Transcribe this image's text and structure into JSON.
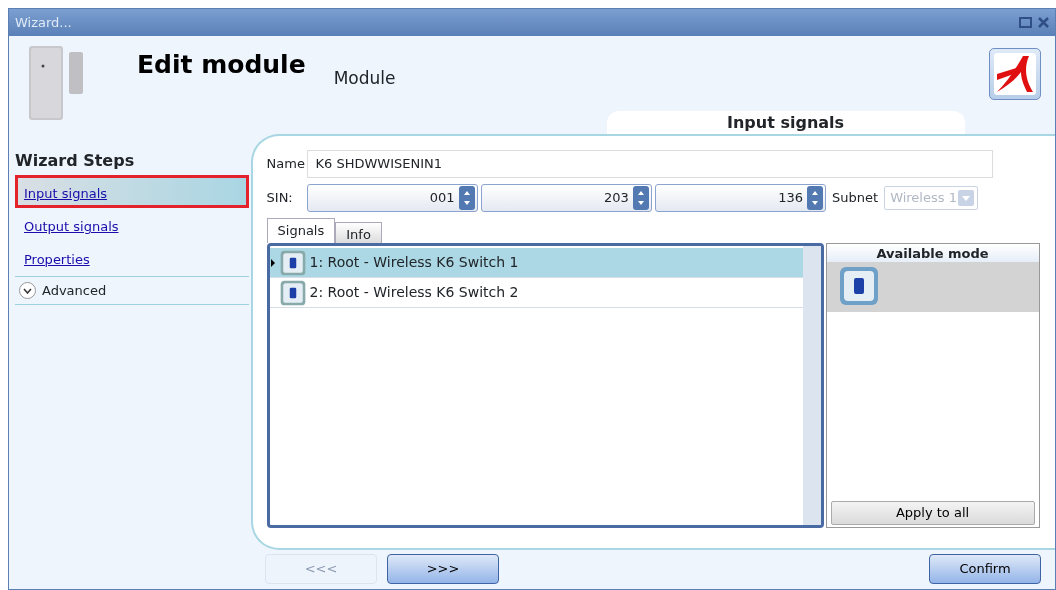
{
  "window": {
    "title": "Wizard..."
  },
  "header": {
    "title": "Edit module",
    "subtitle": "Module"
  },
  "wizard_steps": {
    "heading": "Wizard Steps",
    "items": [
      {
        "label": "Input signals",
        "selected": true
      },
      {
        "label": "Output signals",
        "selected": false
      },
      {
        "label": "Properties",
        "selected": false
      }
    ],
    "advanced": {
      "label": "Advanced",
      "expanded": false
    }
  },
  "panel": {
    "title": "Input signals",
    "name": {
      "label": "Name",
      "value": "K6 SHDWWISENIN1"
    },
    "sin": {
      "label": "SIN:",
      "values": [
        "001",
        "203",
        "136"
      ]
    },
    "subnet": {
      "label": "Subnet",
      "value": "Wireless 1",
      "disabled": true
    },
    "tabs": [
      {
        "label": "Signals",
        "selected": true
      },
      {
        "label": "Info",
        "selected": false
      }
    ],
    "signals": [
      {
        "label": "1: Root - Wireless K6 Switch 1",
        "selected": true
      },
      {
        "label": "2: Root - Wireless K6 Switch 2",
        "selected": false
      }
    ],
    "available_mode": {
      "heading": "Available mode"
    },
    "apply_button": "Apply to all"
  },
  "footer": {
    "buttons": [
      {
        "label": "<<<",
        "disabled": true
      },
      {
        "label": ">>>",
        "disabled": false
      }
    ],
    "confirm": "Confirm"
  }
}
